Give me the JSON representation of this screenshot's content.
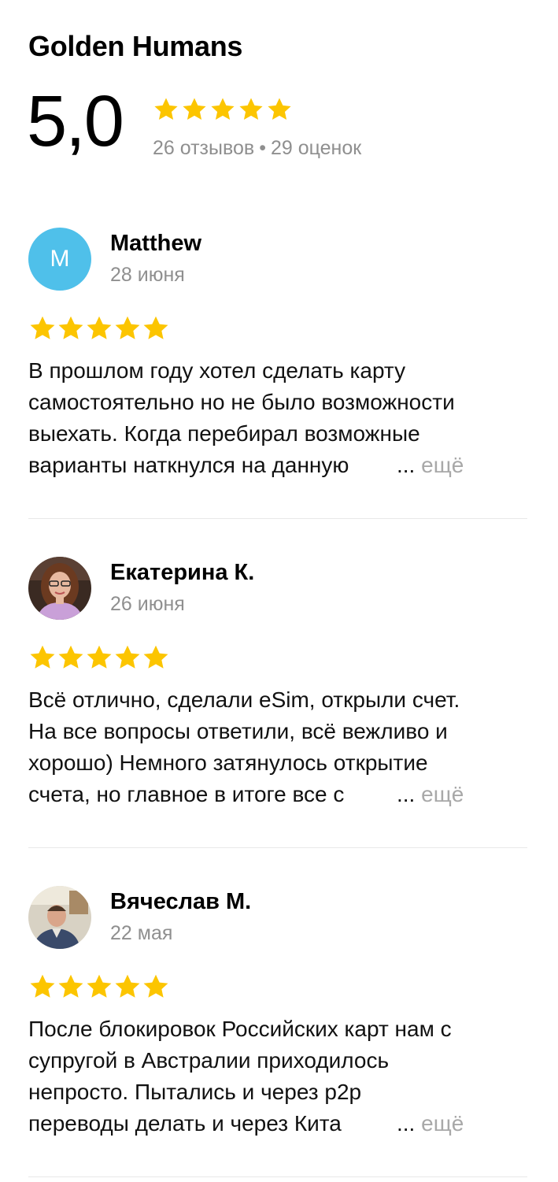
{
  "org": {
    "name": "Golden Humans",
    "rating": "5,0",
    "stars": 5,
    "reviews_count": "26 отзывов",
    "ratings_count": "29 оценок",
    "separator": "•"
  },
  "colors": {
    "star": "#fcc500",
    "muted": "#8f8f8f",
    "avatar_letter_bg": "#4fc0ea"
  },
  "reviews": [
    {
      "author": "Matthew",
      "initial": "M",
      "date": "28 июня",
      "stars": 5,
      "lines": [
        "В прошлом году хотел сделать карту",
        "самостоятельно но не было возможности",
        "выехать. Когда перебирал возможные",
        "варианты наткнулся на данную"
      ],
      "ellipsis": "...",
      "more": "ещё"
    },
    {
      "author": "Екатерина К.",
      "avatar": "photo-woman",
      "date": "26 июня",
      "stars": 5,
      "lines": [
        "Всё отлично, сделали eSim, открыли счет.",
        "На все вопросы ответили, всё вежливо и",
        "хорошо) Немного затянулось открытие",
        "счета, но главное в итоге все с"
      ],
      "ellipsis": "...",
      "more": "ещё"
    },
    {
      "author": "Вячеслав М.",
      "avatar": "photo-man",
      "date": "22 мая",
      "stars": 5,
      "lines": [
        "После блокировок Российских карт нам с",
        "супругой в Австралии приходилось",
        "непросто. Пытались и через p2p",
        "переводы делать и через Кита"
      ],
      "ellipsis": "...",
      "more": "ещё"
    }
  ]
}
